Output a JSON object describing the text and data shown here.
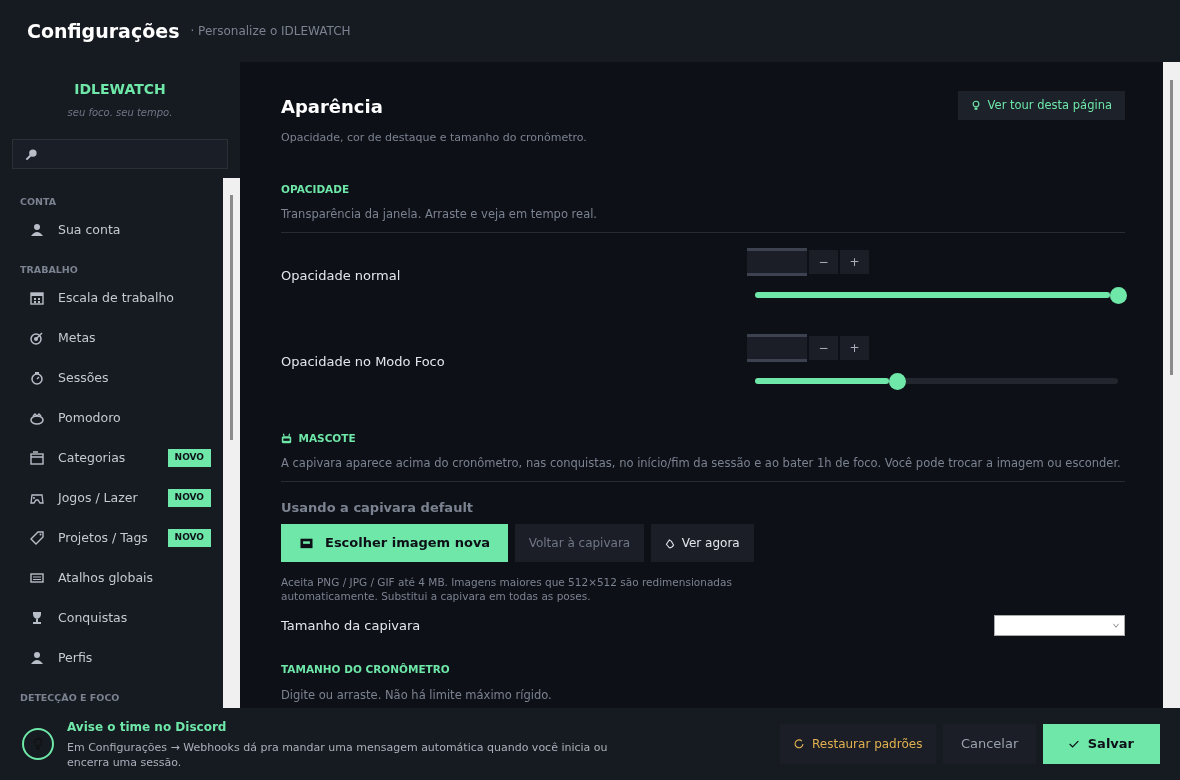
{
  "header": {
    "title": "Configurações",
    "subtitle": "· Personalize o IDLEWATCH"
  },
  "sidebar": {
    "brand": "IDLEWATCH",
    "tagline": "seu foco. seu tempo.",
    "sections": [
      {
        "label": "CONTA",
        "items": [
          {
            "label": "Sua conta",
            "selected": false
          }
        ]
      },
      {
        "label": "TRABALHO",
        "items": [
          {
            "label": "Escala de trabalho",
            "selected": false
          },
          {
            "label": "Metas",
            "selected": false
          },
          {
            "label": "Sessões",
            "selected": false
          },
          {
            "label": "Pomodoro",
            "selected": false
          },
          {
            "label": "Categorias",
            "selected": false,
            "badge": "NOVO"
          },
          {
            "label": "Jogos / Lazer",
            "selected": false,
            "badge": "NOVO"
          },
          {
            "label": "Projetos / Tags",
            "selected": false,
            "badge": "NOVO"
          },
          {
            "label": "Atalhos globais",
            "selected": false
          },
          {
            "label": "Conquistas",
            "selected": false
          },
          {
            "label": "Perfis",
            "selected": false
          }
        ]
      },
      {
        "label": "DETECÇÃO E FOCO"
      }
    ]
  },
  "page": {
    "title": "Aparência",
    "subtitle": "Opacidade, cor de destaque e tamanho do cronômetro.",
    "tour_button": "Ver tour desta página",
    "groups": [
      {
        "heading": "OPACIDADE",
        "description": "Transparência da janela. Arraste e veja em tempo real.",
        "rows": [
          {
            "kind": "slider",
            "label": "Opacidade normal",
            "minus": "−",
            "plus": "+",
            "level": 1.0
          },
          {
            "kind": "slider",
            "label": "Opacidade no Modo Foco",
            "minus": "−",
            "plus": "+",
            "level": 0.39
          }
        ]
      },
      {
        "heading": "MASCOTE",
        "description": "A capivara aparece acima do cronômetro, nas conquistas, no início/fim da sessão e ao bater 1h de foco. Você pode trocar a imagem ou esconder.",
        "rows": [
          {
            "kind": "status",
            "label": "Usando a capivara default"
          },
          {
            "kind": "buttons",
            "buttons": [
              {
                "label": "Escolher imagem nova",
                "kind": "primary"
              },
              {
                "label": "Voltar à capivara",
                "kind": "muted"
              },
              {
                "label": "Ver agora",
                "kind": "secondary"
              }
            ]
          },
          {
            "kind": "hint",
            "label": "Aceita PNG / JPG / GIF até 4 MB. Imagens maiores que 512×512 são redimensionadas automaticamente. Substitui a capivara em todas as poses."
          },
          {
            "kind": "select",
            "label": "Tamanho da capivara"
          }
        ]
      },
      {
        "heading": "TAMANHO DO CRONÔMETRO",
        "description": "Digite ou arraste. Não há limite máximo rígido."
      }
    ]
  },
  "footer": {
    "tip_title": "Avise o time no Discord",
    "tip_text": "Em Configurações → Webhooks dá pra mandar uma mensagem automática quando você inicia ou encerra uma sessão.",
    "buttons": [
      {
        "label": "Restaurar padrões",
        "kind": "reset"
      },
      {
        "label": "Cancelar",
        "kind": "cancel"
      },
      {
        "label": "Salvar",
        "kind": "save"
      }
    ]
  }
}
